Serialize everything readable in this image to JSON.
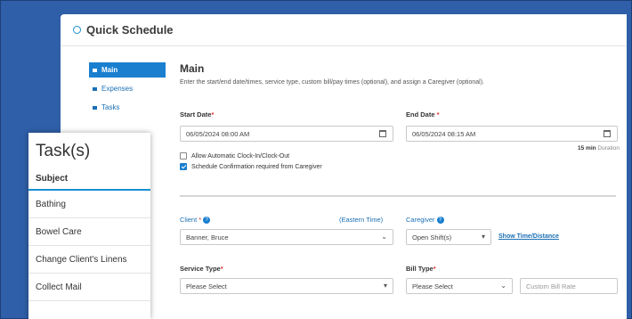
{
  "panel": {
    "title": "Quick Schedule"
  },
  "nav": [
    {
      "label": "Main",
      "active": true
    },
    {
      "label": "Expenses",
      "active": false
    },
    {
      "label": "Tasks",
      "active": false
    }
  ],
  "main": {
    "heading": "Main",
    "description": "Enter the start/end date/times, service type, custom bill/pay times (optional), and assign a Caregiver (optional)."
  },
  "dates": {
    "start_label": "Start Date",
    "start_value": "06/05/2024 08:00 AM",
    "end_label": "End Date",
    "end_value": "06/05/2024 08:15 AM",
    "duration_value": "15 min",
    "duration_unit": "Duration"
  },
  "options": {
    "auto_clock_label": "Allow Automatic Clock-In/Clock-Out",
    "auto_clock_checked": false,
    "confirm_label": "Schedule Confirmation required from Caregiver",
    "confirm_checked": true
  },
  "client": {
    "label": "Client",
    "timezone": "(Eastern Time)",
    "value": "Banner, Bruce"
  },
  "caregiver": {
    "label": "Caregiver",
    "value": "Open Shift(s)",
    "show_link": "Show Time/Distance"
  },
  "service": {
    "label": "Service Type",
    "value": "Please Select"
  },
  "bill": {
    "label": "Bill Type",
    "value": "Please Select",
    "rate_placeholder": "Custom Bill Rate"
  },
  "tasks": {
    "title": "Task(s)",
    "subject_header": "Subject",
    "items": [
      "Bathing",
      "Bowel Care",
      "Change Client's Linens",
      "Collect Mail"
    ]
  },
  "colors": {
    "background": "#2f5fa8",
    "accent": "#1a7fcf"
  }
}
